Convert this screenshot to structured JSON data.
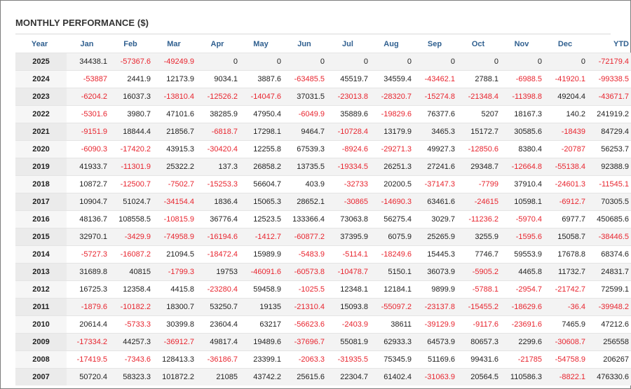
{
  "title": "MONTHLY PERFORMANCE ($)",
  "headers": [
    "Year",
    "Jan",
    "Feb",
    "Mar",
    "Apr",
    "May",
    "Jun",
    "Jul",
    "Aug",
    "Sep",
    "Oct",
    "Nov",
    "Dec",
    "YTD"
  ],
  "rows": [
    [
      "2025",
      "34438.1",
      "-57367.6",
      "-49249.9",
      "0",
      "0",
      "0",
      "0",
      "0",
      "0",
      "0",
      "0",
      "0",
      "-72179.4"
    ],
    [
      "2024",
      "-53887",
      "2441.9",
      "12173.9",
      "9034.1",
      "3887.6",
      "-63485.5",
      "45519.7",
      "34559.4",
      "-43462.1",
      "2788.1",
      "-6988.5",
      "-41920.1",
      "-99338.5"
    ],
    [
      "2023",
      "-6204.2",
      "16037.3",
      "-13810.4",
      "-12526.2",
      "-14047.6",
      "37031.5",
      "-23013.8",
      "-28320.7",
      "-15274.8",
      "-21348.4",
      "-11398.8",
      "49204.4",
      "-43671.7"
    ],
    [
      "2022",
      "-5301.6",
      "3980.7",
      "47101.6",
      "38285.9",
      "47950.4",
      "-6049.9",
      "35889.6",
      "-19829.6",
      "76377.6",
      "5207",
      "18167.3",
      "140.2",
      "241919.2"
    ],
    [
      "2021",
      "-9151.9",
      "18844.4",
      "21856.7",
      "-6818.7",
      "17298.1",
      "9464.7",
      "-10728.4",
      "13179.9",
      "3465.3",
      "15172.7",
      "30585.6",
      "-18439",
      "84729.4"
    ],
    [
      "2020",
      "-6090.3",
      "-17420.2",
      "43915.3",
      "-30420.4",
      "12255.8",
      "67539.3",
      "-8924.6",
      "-29271.3",
      "49927.3",
      "-12850.6",
      "8380.4",
      "-20787",
      "56253.7"
    ],
    [
      "2019",
      "41933.7",
      "-11301.9",
      "25322.2",
      "137.3",
      "26858.2",
      "13735.5",
      "-19334.5",
      "26251.3",
      "27241.6",
      "29348.7",
      "-12664.8",
      "-55138.4",
      "92388.9"
    ],
    [
      "2018",
      "10872.7",
      "-12500.7",
      "-7502.7",
      "-15253.3",
      "56604.7",
      "403.9",
      "-32733",
      "20200.5",
      "-37147.3",
      "-7799",
      "37910.4",
      "-24601.3",
      "-11545.1"
    ],
    [
      "2017",
      "10904.7",
      "51024.7",
      "-34154.4",
      "1836.4",
      "15065.3",
      "28652.1",
      "-30865",
      "-14690.3",
      "63461.6",
      "-24615",
      "10598.1",
      "-6912.7",
      "70305.5"
    ],
    [
      "2016",
      "48136.7",
      "108558.5",
      "-10815.9",
      "36776.4",
      "12523.5",
      "133366.4",
      "73063.8",
      "56275.4",
      "3029.7",
      "-11236.2",
      "-5970.4",
      "6977.7",
      "450685.6"
    ],
    [
      "2015",
      "32970.1",
      "-3429.9",
      "-74958.9",
      "-16194.6",
      "-1412.7",
      "-60877.2",
      "37395.9",
      "6075.9",
      "25265.9",
      "3255.9",
      "-1595.6",
      "15058.7",
      "-38446.5"
    ],
    [
      "2014",
      "-5727.3",
      "-16087.2",
      "21094.5",
      "-18472.4",
      "15989.9",
      "-5483.9",
      "-5114.1",
      "-18249.6",
      "15445.3",
      "7746.7",
      "59553.9",
      "17678.8",
      "68374.6"
    ],
    [
      "2013",
      "31689.8",
      "40815",
      "-1799.3",
      "19753",
      "-46091.6",
      "-60573.8",
      "-10478.7",
      "5150.1",
      "36073.9",
      "-5905.2",
      "4465.8",
      "11732.7",
      "24831.7"
    ],
    [
      "2012",
      "16725.3",
      "12358.4",
      "4415.8",
      "-23280.4",
      "59458.9",
      "-1025.5",
      "12348.1",
      "12184.1",
      "9899.9",
      "-5788.1",
      "-2954.7",
      "-21742.7",
      "72599.1"
    ],
    [
      "2011",
      "-1879.6",
      "-10182.2",
      "18300.7",
      "53250.7",
      "19135",
      "-21310.4",
      "15093.8",
      "-55097.2",
      "-23137.8",
      "-15455.2",
      "-18629.6",
      "-36.4",
      "-39948.2"
    ],
    [
      "2010",
      "20614.4",
      "-5733.3",
      "30399.8",
      "23604.4",
      "63217",
      "-56623.6",
      "-2403.9",
      "38611",
      "-39129.9",
      "-9117.6",
      "-23691.6",
      "7465.9",
      "47212.6"
    ],
    [
      "2009",
      "-17334.2",
      "44257.3",
      "-36912.7",
      "49817.4",
      "19489.6",
      "-37696.7",
      "55081.9",
      "62933.3",
      "64573.9",
      "80657.3",
      "2299.6",
      "-30608.7",
      "256558"
    ],
    [
      "2008",
      "-17419.5",
      "-7343.6",
      "128413.3",
      "-36186.7",
      "23399.1",
      "-2063.3",
      "-31935.5",
      "75345.9",
      "51169.6",
      "99431.6",
      "-21785",
      "-54758.9",
      "206267"
    ],
    [
      "2007",
      "50720.4",
      "58323.3",
      "101872.2",
      "21085",
      "43742.2",
      "25615.6",
      "22304.7",
      "61402.4",
      "-31063.9",
      "20564.5",
      "110586.3",
      "-8822.1",
      "476330.6"
    ]
  ],
  "colors": {
    "negative": "#e8252f",
    "header": "#2f5f8f",
    "text": "#222222"
  }
}
